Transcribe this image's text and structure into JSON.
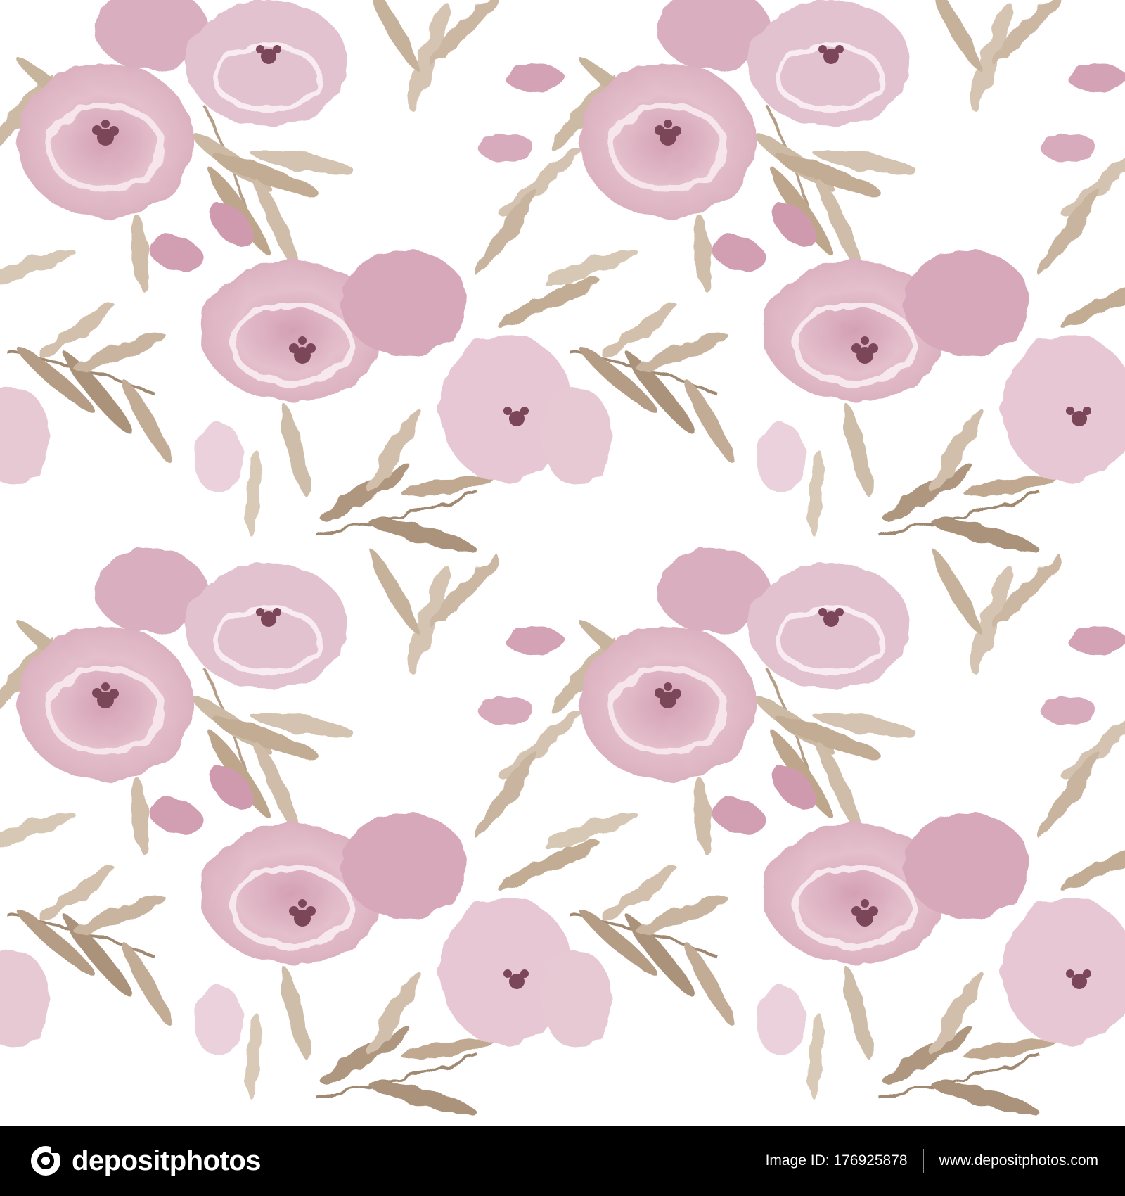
{
  "image": {
    "description_role": "seamless-watercolor-floral-pattern",
    "colors": {
      "background": "#ffffff",
      "petal_light": "#e9c9d3",
      "petal_mid": "#d7a9b9",
      "petal_dark": "#c4899c",
      "flower_center": "#7a4658",
      "leaf_light": "#d8c8b4",
      "leaf_mid": "#bda78c",
      "leaf_dark": "#9a8066"
    }
  },
  "footer": {
    "brand": "depositphotos",
    "brand_icon": "depositphotos-logo-icon",
    "image_id": "Image ID: 176925878",
    "website": "www.depositphotos.com",
    "background": "#000000"
  }
}
